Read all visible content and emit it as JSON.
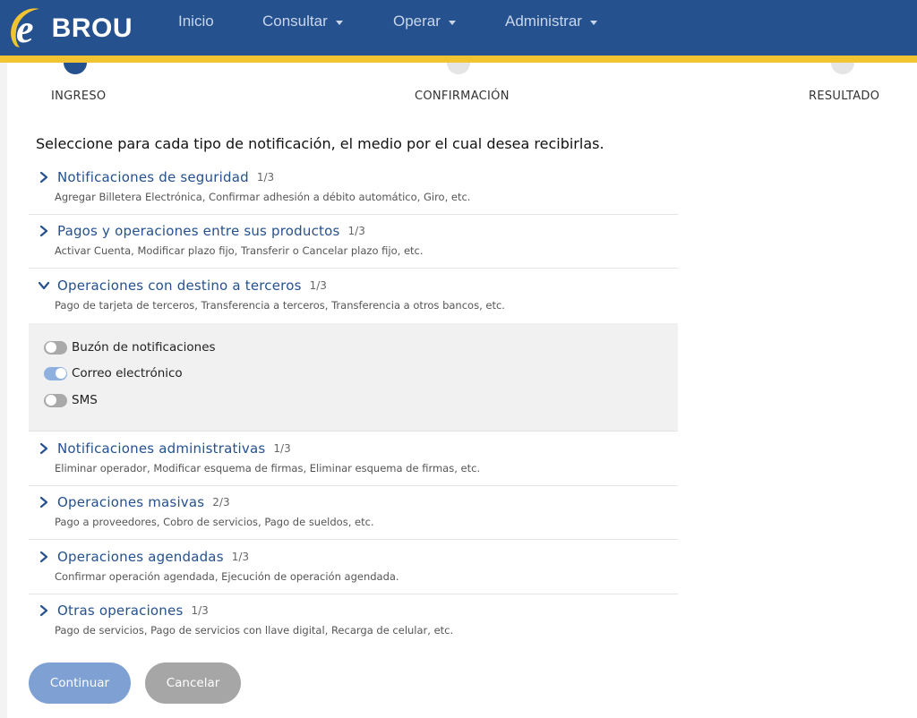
{
  "header": {
    "brand": "BROU",
    "logo_letter": "e",
    "nav": [
      {
        "label": "Inicio",
        "dropdown": false
      },
      {
        "label": "Consultar",
        "dropdown": true
      },
      {
        "label": "Operar",
        "dropdown": true
      },
      {
        "label": "Administrar",
        "dropdown": true
      }
    ]
  },
  "steps": [
    {
      "label": "INGRESO",
      "state": "active"
    },
    {
      "label": "CONFIRMACIÓN",
      "state": "pending"
    },
    {
      "label": "RESULTADO",
      "state": "pending"
    }
  ],
  "heading": "Seleccione para cada tipo de notificación, el medio por el cual desea recibirlas.",
  "sections": [
    {
      "title": "Notificaciones de seguridad",
      "count": "1/3",
      "desc": "Agregar Billetera Electrónica, Confirmar adhesión a débito automático, Giro, etc.",
      "expanded": false
    },
    {
      "title": "Pagos y operaciones entre sus productos",
      "count": "1/3",
      "desc": "Activar Cuenta, Modificar plazo fijo, Transferir o Cancelar plazo fijo, etc.",
      "expanded": false
    },
    {
      "title": "Operaciones con destino a terceros",
      "count": "1/3",
      "desc": "Pago de tarjeta de terceros, Transferencia a terceros, Transferencia a otros bancos, etc.",
      "expanded": true
    },
    {
      "title": "Notificaciones administrativas",
      "count": "1/3",
      "desc": "Eliminar operador, Modificar esquema de firmas, Eliminar esquema de firmas, etc.",
      "expanded": false
    },
    {
      "title": "Operaciones masivas",
      "count": "2/3",
      "desc": "Pago a proveedores, Cobro de servicios, Pago de sueldos, etc.",
      "expanded": false
    },
    {
      "title": "Operaciones agendadas",
      "count": "1/3",
      "desc": "Confirmar operación agendada, Ejecución de operación agendada.",
      "expanded": false
    },
    {
      "title": "Otras operaciones",
      "count": "1/3",
      "desc": "Pago de servicios, Pago de servicios con llave digital, Recarga de celular, etc.",
      "expanded": false
    }
  ],
  "channels": [
    {
      "label": "Buzón de notificaciones",
      "enabled": false
    },
    {
      "label": "Correo electrónico",
      "enabled": true
    },
    {
      "label": "SMS",
      "enabled": false
    }
  ],
  "buttons": {
    "continue": "Continuar",
    "cancel": "Cancelar"
  },
  "colors": {
    "primary": "#25518f",
    "accent_stripe": "#f2c431",
    "button_primary": "#7ea0d3",
    "button_secondary": "#a6a6a6",
    "toggle_on": "#8fb1e0",
    "toggle_off": "#a9a9a9"
  }
}
